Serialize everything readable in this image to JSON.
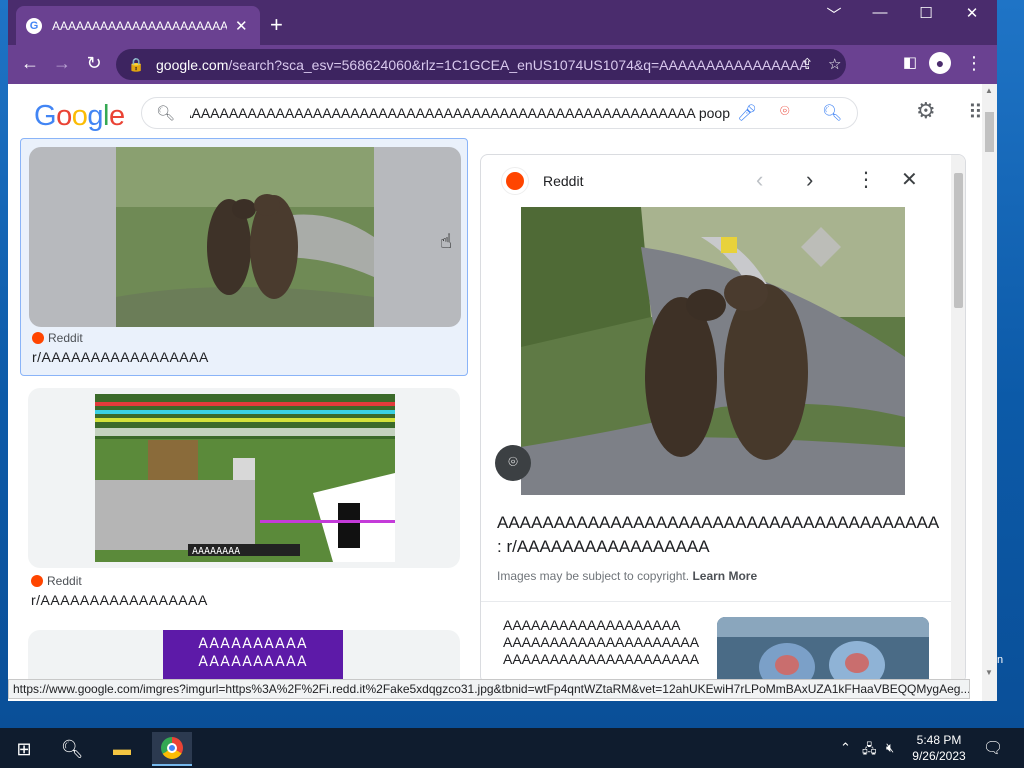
{
  "browser": {
    "tab_title": "AAAAAAAAAAAAAAAAAAAAAAA",
    "new_tab_symbol": "+",
    "url_host": "google.com",
    "url_path": "/search?sca_esv=568624060&rlz=1C1GCEA_enUS1074US1074&q=AAAAAAAAAAAAAAAAAAA...",
    "window_controls": [
      "﹀",
      "—",
      "☐",
      "✕"
    ]
  },
  "search": {
    "logo_text": "Google",
    "query": "AAAAAAAAAAAAAAAAAAAAAAAAAAAAAAAAAAAAAAAAAAAAAAAAAAAAAAAAAAAAAAAAAAA poop"
  },
  "results": [
    {
      "source": "Reddit",
      "title": "r/AAAAAAAAAAAAAAAAA"
    },
    {
      "source": "Reddit",
      "title": "r/AAAAAAAAAAAAAAAAA"
    },
    {
      "thumb_text_line1": "AAAAAAAAAA",
      "thumb_text_line2": "AAAAAAAAAA"
    }
  ],
  "panel": {
    "source": "Reddit",
    "title_line1": "AAAAAAAAAAAAAAAAAAAAAAAAAAAAAAAAAAAAAAA",
    "title_line2": ": r/AAAAAAAAAAAAAAAAA",
    "copyright": "Images may be subject to copyright.",
    "learn_more": "Learn More",
    "related_text": [
      "AAAAAAAAAAAAAAAAAAA",
      "AAAAAAAAAAAAAAAAAAAAAA",
      "AAAAAAAAAAAAAAAAAAAAA"
    ]
  },
  "minecraft_overlay": "AAAAAAAA",
  "status_url": "https://www.google.com/imgres?imgurl=https%3A%2F%2Fi.redd.it%2Fake5xdqgzco31.jpg&tbnid=wtFp4qntWZtaRM&vet=12ahUKEwiH7rLPoMmBAxUZA1kFHaaVBEQQMygAeg...",
  "taskbar": {
    "time": "5:48 PM",
    "date": "9/26/2023"
  },
  "desktop_edge_text": "n",
  "colors": {
    "tab_bar": "#4a2c6d",
    "toolbar": "#6a4191",
    "reddit": "#ff4500",
    "taskbar": "#0f1c2e"
  }
}
